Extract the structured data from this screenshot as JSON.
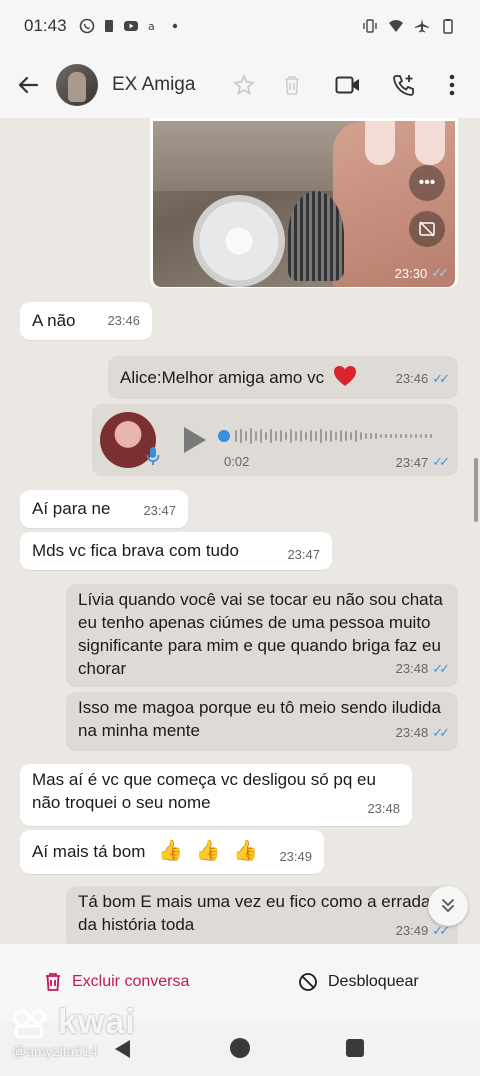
{
  "statusbar": {
    "time": "01:43"
  },
  "header": {
    "contact_name": "EX Amiga"
  },
  "image_message": {
    "time": "23:30"
  },
  "messages": [
    {
      "id": "m1",
      "dir": "in",
      "text": "A  não",
      "time": "23:46"
    },
    {
      "id": "m2",
      "dir": "out",
      "text": "Alice:Melhor amiga amo vc",
      "time": "23:46",
      "emoji": "heart"
    },
    {
      "id": "m4",
      "dir": "in",
      "text": "Aí  para ne",
      "time": "23:47"
    },
    {
      "id": "m5",
      "dir": "in",
      "text": "Mds vc fica brava com tudo",
      "time": "23:47"
    },
    {
      "id": "m6",
      "dir": "out",
      "text": "Lívia quando você vai se tocar eu não sou chata eu tenho apenas ciúmes de uma pessoa muito significante para mim e que quando briga faz eu chorar",
      "time": "23:48"
    },
    {
      "id": "m7",
      "dir": "out",
      "text": "Isso me magoa porque eu tô meio sendo iludida na minha mente",
      "time": "23:48"
    },
    {
      "id": "m8",
      "dir": "in",
      "text": "Mas aí é vc que começa  vc desligou só pq eu não troquei o seu nome",
      "time": "23:48"
    },
    {
      "id": "m9",
      "dir": "in",
      "text": "Aí mais tá bom",
      "time": "23:49",
      "emoji": "thumbs-up x3"
    },
    {
      "id": "m10",
      "dir": "out",
      "text": "Tá bom E mais uma vez eu fico como a errada da história toda",
      "time": "23:49"
    }
  ],
  "voice_message": {
    "duration": "0:02",
    "time": "23:47",
    "progress": 0
  },
  "bottom_bar": {
    "delete_label": "Excluir conversa",
    "unblock_label": "Desbloquear"
  },
  "watermark": {
    "brand": "kwai",
    "handle": "@amyzita514"
  },
  "colors": {
    "accent_delete": "#c2185b",
    "read_ticks": "#4a90e2",
    "outgoing_bubble": "#dedad6",
    "incoming_bubble": "#ffffff"
  }
}
